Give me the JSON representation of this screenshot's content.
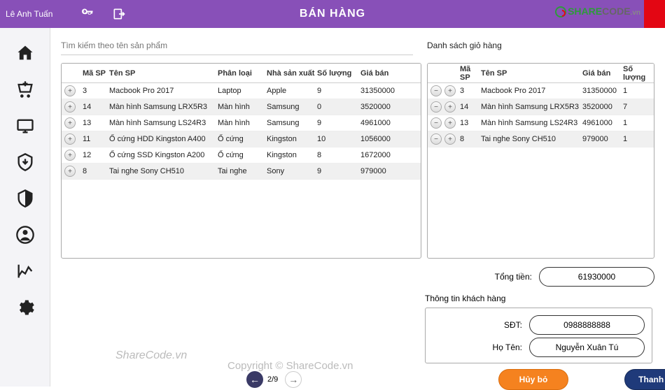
{
  "topbar": {
    "user": "Lê Anh Tuấn",
    "title": "BÁN HÀNG"
  },
  "search": {
    "placeholder": "Tìm kiếm theo tên sản phẩm"
  },
  "cart_title": "Danh sách giỏ hàng",
  "products": {
    "headers": {
      "id": "Mã SP",
      "name": "Tên SP",
      "cat": "Phân loại",
      "mfr": "Nhà sản xuất",
      "qty": "Số lượng",
      "price": "Giá bán"
    },
    "rows": [
      {
        "id": "3",
        "name": "Macbook Pro 2017",
        "cat": "Laptop",
        "mfr": "Apple",
        "qty": "9",
        "price": "31350000"
      },
      {
        "id": "14",
        "name": "Màn hình Samsung LRX5R3",
        "cat": "Màn hình",
        "mfr": "Samsung",
        "qty": "0",
        "price": "3520000"
      },
      {
        "id": "13",
        "name": "Màn hình Samsung LS24R3",
        "cat": "Màn hình",
        "mfr": "Samsung",
        "qty": "9",
        "price": "4961000"
      },
      {
        "id": "11",
        "name": "Ổ cứng HDD Kingston A400",
        "cat": "Ổ cứng",
        "mfr": "Kingston",
        "qty": "10",
        "price": "1056000"
      },
      {
        "id": "12",
        "name": "Ổ cứng SSD Kingston A200",
        "cat": "Ổ cứng",
        "mfr": "Kingston",
        "qty": "8",
        "price": "1672000"
      },
      {
        "id": "8",
        "name": "Tai nghe Sony CH510",
        "cat": "Tai nghe",
        "mfr": "Sony",
        "qty": "9",
        "price": "979000"
      }
    ]
  },
  "cart": {
    "headers": {
      "id": "Mã SP",
      "name": "Tên SP",
      "price": "Giá bán",
      "qty": "Số lượng"
    },
    "rows": [
      {
        "id": "3",
        "name": "Macbook Pro 2017",
        "price": "31350000",
        "qty": "1"
      },
      {
        "id": "14",
        "name": "Màn hình Samsung LRX5R3",
        "price": "3520000",
        "qty": "7"
      },
      {
        "id": "13",
        "name": "Màn hình Samsung LS24R3",
        "price": "4961000",
        "qty": "1"
      },
      {
        "id": "8",
        "name": "Tai nghe Sony CH510",
        "price": "979000",
        "qty": "1"
      }
    ]
  },
  "total": {
    "label": "Tổng tiền:",
    "value": "61930000"
  },
  "customer": {
    "title": "Thông tin khách hàng",
    "phone_label": "SĐT:",
    "phone": "0988888888",
    "name_label": "Họ Tên:",
    "name": "Nguyễn Xuân Tú"
  },
  "pager": {
    "text": "2/9"
  },
  "buttons": {
    "cancel": "Hủy bỏ",
    "pay": "Thanh toán"
  },
  "watermark": {
    "sc": "ShareCode.vn",
    "copy": "Copyright © ShareCode.vn"
  }
}
